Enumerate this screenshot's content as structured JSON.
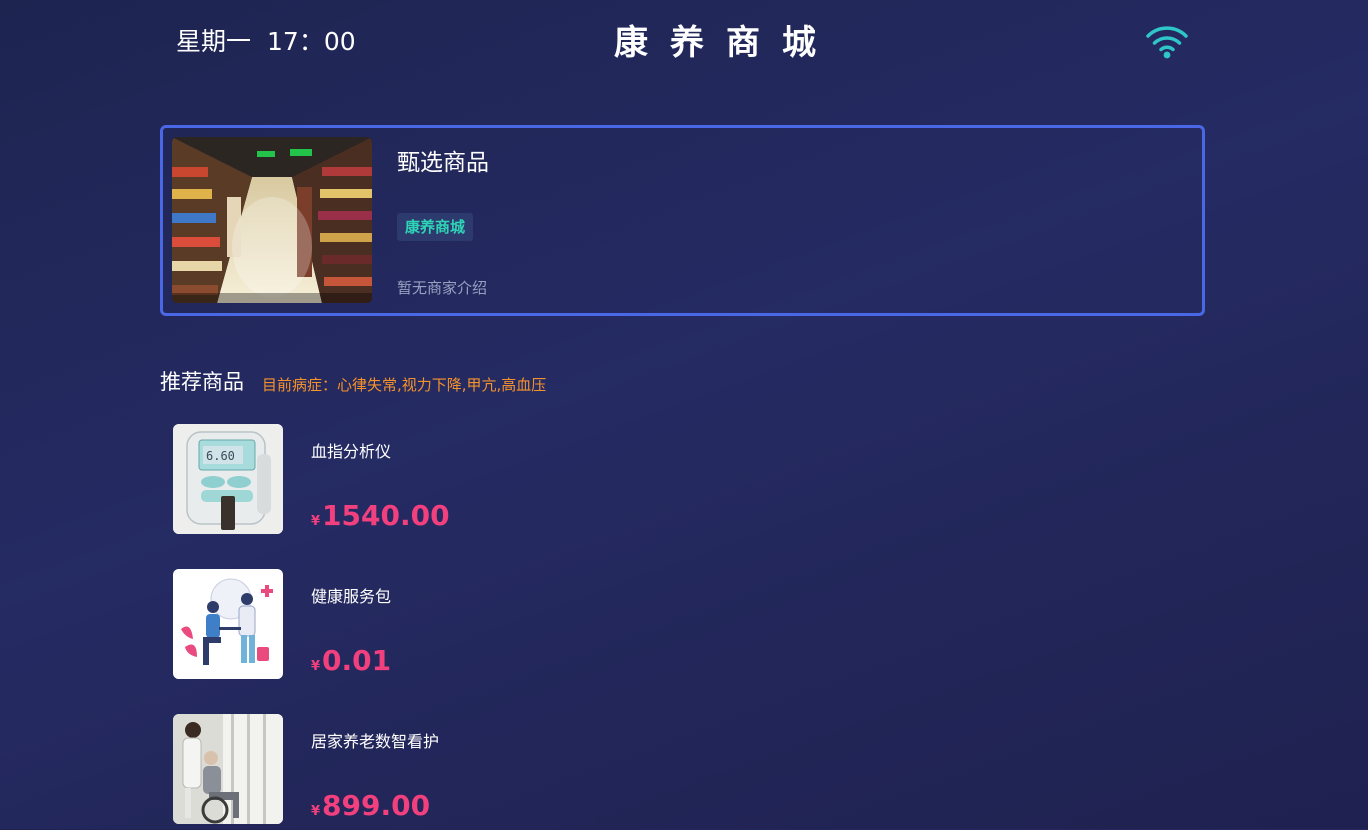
{
  "status_bar": {
    "weekday": "星期一",
    "time": "17：00",
    "wifi_icon": "wifi-icon"
  },
  "header": {
    "title": "康养商城"
  },
  "featured": {
    "title": "甄选商品",
    "tag": "康养商城",
    "description": "暂无商家介绍",
    "image_icon": "supermarket-aisle-photo"
  },
  "recommended": {
    "heading": "推荐商品",
    "condition_text": "目前病症：心律失常,视力下降,甲亢,高血压",
    "currency_symbol": "¥",
    "items": [
      {
        "name": "血指分析仪",
        "price": "1540.00",
        "image_icon": "blood-analyzer-photo"
      },
      {
        "name": "健康服务包",
        "price": "0.01",
        "image_icon": "health-service-illustration"
      },
      {
        "name": "居家养老数智看护",
        "price": "899.00",
        "image_icon": "elderly-care-photo"
      }
    ]
  },
  "colors": {
    "accent_border": "#4a68e6",
    "tag_text": "#2fd3b5",
    "condition_text": "#f5922b",
    "price": "#f23f7e",
    "wifi": "#2fc6c8"
  }
}
